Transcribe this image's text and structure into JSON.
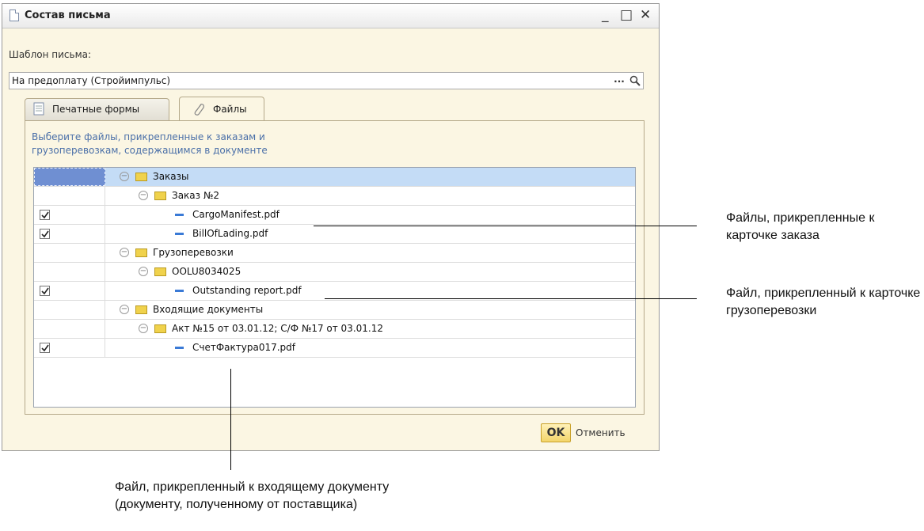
{
  "window": {
    "title": "Состав письма",
    "controls": {
      "minimize": "_",
      "maximize": "□",
      "close": "✕"
    }
  },
  "template": {
    "label": "Шаблон письма:",
    "value": "На предоплату (Стройимпульс)",
    "select_label": "...",
    "search_icon": "magnifier-icon"
  },
  "tabs": [
    {
      "label": "Печатные формы",
      "icon": "document-icon",
      "active": false
    },
    {
      "label": "Файлы",
      "icon": "paperclip-icon",
      "active": true
    }
  ],
  "hint": "Выберите файлы, прикрепленные к заказам и грузоперевозкам, содержащимся в документе",
  "tree": [
    {
      "label": "Заказы",
      "type": "folder",
      "level": 0,
      "checked": null,
      "selected": true
    },
    {
      "label": "Заказ №2",
      "type": "folder",
      "level": 1,
      "checked": null
    },
    {
      "label": "CargoManifest.pdf",
      "type": "file",
      "level": 2,
      "checked": true
    },
    {
      "label": "BillOfLading.pdf",
      "type": "file",
      "level": 2,
      "checked": true
    },
    {
      "label": "Грузоперевозки",
      "type": "folder",
      "level": 0,
      "checked": null
    },
    {
      "label": "OOLU8034025",
      "type": "folder",
      "level": 1,
      "checked": null
    },
    {
      "label": "Outstanding report.pdf",
      "type": "file",
      "level": 2,
      "checked": true
    },
    {
      "label": "Входящие документы",
      "type": "folder",
      "level": 0,
      "checked": null
    },
    {
      "label": "Акт №15 от 03.01.12; С/Ф №17 от 03.01.12",
      "type": "folder",
      "level": 1,
      "checked": null
    },
    {
      "label": "СчетФактура017.pdf",
      "type": "file",
      "level": 2,
      "checked": true
    }
  ],
  "buttons": {
    "ok": "OK",
    "cancel": "Отменить"
  },
  "annotations": {
    "order_files": "Файлы, прикрепленные к карточке заказа",
    "shipment_file": "Файл, прикрепленный к карточке грузоперевозки",
    "incoming_file": "Файл, прикрепленный к входящему документу (документу, полученному от поставщика)"
  },
  "colors": {
    "background": "#fbf6e3",
    "hint": "#4a6fa8",
    "selection": "#c4dcf6",
    "ok": "#f3d56a"
  }
}
